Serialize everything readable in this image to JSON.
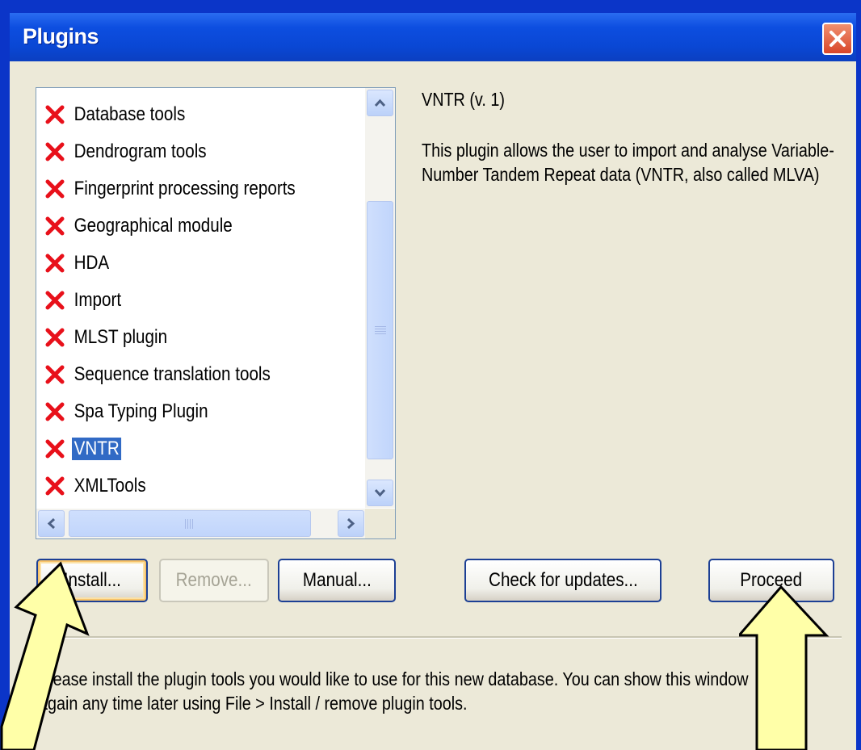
{
  "window": {
    "title": "Plugins",
    "close_icon": "close-icon"
  },
  "plugin_list": {
    "items": [
      {
        "label": "Database tools",
        "selected": false,
        "icon": "red-x-icon"
      },
      {
        "label": "Dendrogram tools",
        "selected": false,
        "icon": "red-x-icon"
      },
      {
        "label": "Fingerprint processing reports",
        "selected": false,
        "icon": "red-x-icon"
      },
      {
        "label": "Geographical module",
        "selected": false,
        "icon": "red-x-icon"
      },
      {
        "label": "HDA",
        "selected": false,
        "icon": "red-x-icon"
      },
      {
        "label": "Import",
        "selected": false,
        "icon": "red-x-icon"
      },
      {
        "label": "MLST plugin",
        "selected": false,
        "icon": "red-x-icon"
      },
      {
        "label": "Sequence translation tools",
        "selected": false,
        "icon": "red-x-icon"
      },
      {
        "label": "Spa Typing Plugin",
        "selected": false,
        "icon": "red-x-icon"
      },
      {
        "label": "VNTR",
        "selected": true,
        "icon": "red-x-icon"
      },
      {
        "label": "XMLTools",
        "selected": false,
        "icon": "red-x-icon"
      }
    ]
  },
  "details": {
    "title": "VNTR (v. 1)",
    "description": "This plugin allows the user to import and analyse Variable-Number Tandem Repeat data (VNTR, also called MLVA)"
  },
  "buttons": {
    "install": "Install...",
    "remove": "Remove...",
    "manual": "Manual...",
    "check_updates": "Check for updates...",
    "proceed": "Proceed"
  },
  "footer": {
    "text": "Please install the plugin tools you would like to use for this new database. You can show this window again any time later using File > Install / remove plugin tools."
  },
  "colors": {
    "selection": "#316ac5",
    "x_icon": "#e8101a",
    "arrow_fill": "#ffffa8",
    "desktop": "#0b35c8"
  }
}
